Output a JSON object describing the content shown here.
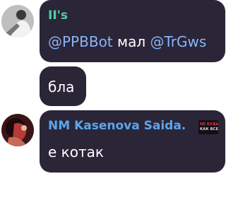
{
  "colors": {
    "bubble_bg": "#2a2537",
    "message_text": "#ffffff",
    "mention": "#8ab4f8",
    "sender_1": "#4fd1a5",
    "sender_2": "#5aa6ee"
  },
  "messages": [
    {
      "sender": "II's",
      "text": {
        "mention_1": "@PPBBot",
        "middle": " мал ",
        "mention_2": "@TrGws"
      }
    },
    {
      "text": "бла"
    },
    {
      "sender": "NM Kasenova Saida.",
      "badge": {
        "line_1": "НЕ БУДЬ",
        "line_2": "КАК ВСЕ"
      },
      "text": "е котак"
    }
  ]
}
